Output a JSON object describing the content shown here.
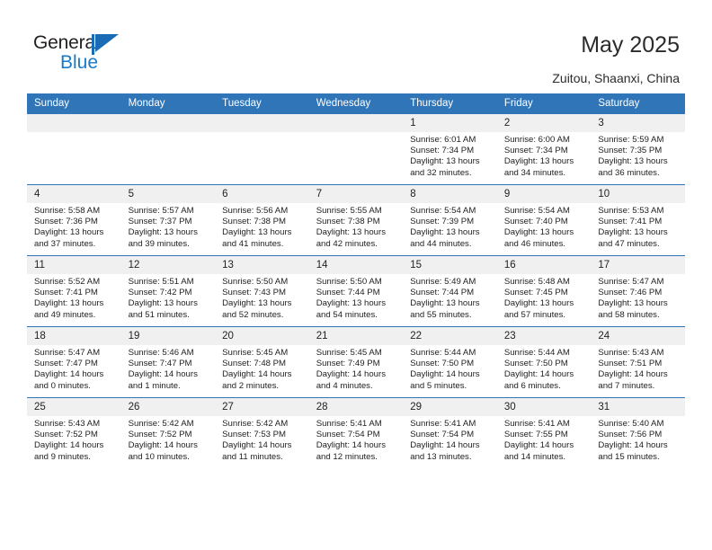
{
  "brand": {
    "name_part1": "General",
    "name_part2": "Blue",
    "accent_color": "#1a7ac8",
    "flag_icon": "triangle-flag-icon"
  },
  "header": {
    "title": "May 2025",
    "subtitle": "Zuitou, Shaanxi, China",
    "header_bg_color": "#3075b8",
    "daynum_bg_color": "#f0f0f0"
  },
  "weekday_headers": [
    "Sunday",
    "Monday",
    "Tuesday",
    "Wednesday",
    "Thursday",
    "Friday",
    "Saturday"
  ],
  "weeks": [
    [
      {
        "date": "",
        "empty": true,
        "sunrise": "",
        "sunset": "",
        "daylight1": "",
        "daylight2": ""
      },
      {
        "date": "",
        "empty": true,
        "sunrise": "",
        "sunset": "",
        "daylight1": "",
        "daylight2": ""
      },
      {
        "date": "",
        "empty": true,
        "sunrise": "",
        "sunset": "",
        "daylight1": "",
        "daylight2": ""
      },
      {
        "date": "",
        "empty": true,
        "sunrise": "",
        "sunset": "",
        "daylight1": "",
        "daylight2": ""
      },
      {
        "date": "1",
        "empty": false,
        "sunrise": "Sunrise: 6:01 AM",
        "sunset": "Sunset: 7:34 PM",
        "daylight1": "Daylight: 13 hours",
        "daylight2": "and 32 minutes."
      },
      {
        "date": "2",
        "empty": false,
        "sunrise": "Sunrise: 6:00 AM",
        "sunset": "Sunset: 7:34 PM",
        "daylight1": "Daylight: 13 hours",
        "daylight2": "and 34 minutes."
      },
      {
        "date": "3",
        "empty": false,
        "sunrise": "Sunrise: 5:59 AM",
        "sunset": "Sunset: 7:35 PM",
        "daylight1": "Daylight: 13 hours",
        "daylight2": "and 36 minutes."
      }
    ],
    [
      {
        "date": "4",
        "empty": false,
        "sunrise": "Sunrise: 5:58 AM",
        "sunset": "Sunset: 7:36 PM",
        "daylight1": "Daylight: 13 hours",
        "daylight2": "and 37 minutes."
      },
      {
        "date": "5",
        "empty": false,
        "sunrise": "Sunrise: 5:57 AM",
        "sunset": "Sunset: 7:37 PM",
        "daylight1": "Daylight: 13 hours",
        "daylight2": "and 39 minutes."
      },
      {
        "date": "6",
        "empty": false,
        "sunrise": "Sunrise: 5:56 AM",
        "sunset": "Sunset: 7:38 PM",
        "daylight1": "Daylight: 13 hours",
        "daylight2": "and 41 minutes."
      },
      {
        "date": "7",
        "empty": false,
        "sunrise": "Sunrise: 5:55 AM",
        "sunset": "Sunset: 7:38 PM",
        "daylight1": "Daylight: 13 hours",
        "daylight2": "and 42 minutes."
      },
      {
        "date": "8",
        "empty": false,
        "sunrise": "Sunrise: 5:54 AM",
        "sunset": "Sunset: 7:39 PM",
        "daylight1": "Daylight: 13 hours",
        "daylight2": "and 44 minutes."
      },
      {
        "date": "9",
        "empty": false,
        "sunrise": "Sunrise: 5:54 AM",
        "sunset": "Sunset: 7:40 PM",
        "daylight1": "Daylight: 13 hours",
        "daylight2": "and 46 minutes."
      },
      {
        "date": "10",
        "empty": false,
        "sunrise": "Sunrise: 5:53 AM",
        "sunset": "Sunset: 7:41 PM",
        "daylight1": "Daylight: 13 hours",
        "daylight2": "and 47 minutes."
      }
    ],
    [
      {
        "date": "11",
        "empty": false,
        "sunrise": "Sunrise: 5:52 AM",
        "sunset": "Sunset: 7:41 PM",
        "daylight1": "Daylight: 13 hours",
        "daylight2": "and 49 minutes."
      },
      {
        "date": "12",
        "empty": false,
        "sunrise": "Sunrise: 5:51 AM",
        "sunset": "Sunset: 7:42 PM",
        "daylight1": "Daylight: 13 hours",
        "daylight2": "and 51 minutes."
      },
      {
        "date": "13",
        "empty": false,
        "sunrise": "Sunrise: 5:50 AM",
        "sunset": "Sunset: 7:43 PM",
        "daylight1": "Daylight: 13 hours",
        "daylight2": "and 52 minutes."
      },
      {
        "date": "14",
        "empty": false,
        "sunrise": "Sunrise: 5:50 AM",
        "sunset": "Sunset: 7:44 PM",
        "daylight1": "Daylight: 13 hours",
        "daylight2": "and 54 minutes."
      },
      {
        "date": "15",
        "empty": false,
        "sunrise": "Sunrise: 5:49 AM",
        "sunset": "Sunset: 7:44 PM",
        "daylight1": "Daylight: 13 hours",
        "daylight2": "and 55 minutes."
      },
      {
        "date": "16",
        "empty": false,
        "sunrise": "Sunrise: 5:48 AM",
        "sunset": "Sunset: 7:45 PM",
        "daylight1": "Daylight: 13 hours",
        "daylight2": "and 57 minutes."
      },
      {
        "date": "17",
        "empty": false,
        "sunrise": "Sunrise: 5:47 AM",
        "sunset": "Sunset: 7:46 PM",
        "daylight1": "Daylight: 13 hours",
        "daylight2": "and 58 minutes."
      }
    ],
    [
      {
        "date": "18",
        "empty": false,
        "sunrise": "Sunrise: 5:47 AM",
        "sunset": "Sunset: 7:47 PM",
        "daylight1": "Daylight: 14 hours",
        "daylight2": "and 0 minutes."
      },
      {
        "date": "19",
        "empty": false,
        "sunrise": "Sunrise: 5:46 AM",
        "sunset": "Sunset: 7:47 PM",
        "daylight1": "Daylight: 14 hours",
        "daylight2": "and 1 minute."
      },
      {
        "date": "20",
        "empty": false,
        "sunrise": "Sunrise: 5:45 AM",
        "sunset": "Sunset: 7:48 PM",
        "daylight1": "Daylight: 14 hours",
        "daylight2": "and 2 minutes."
      },
      {
        "date": "21",
        "empty": false,
        "sunrise": "Sunrise: 5:45 AM",
        "sunset": "Sunset: 7:49 PM",
        "daylight1": "Daylight: 14 hours",
        "daylight2": "and 4 minutes."
      },
      {
        "date": "22",
        "empty": false,
        "sunrise": "Sunrise: 5:44 AM",
        "sunset": "Sunset: 7:50 PM",
        "daylight1": "Daylight: 14 hours",
        "daylight2": "and 5 minutes."
      },
      {
        "date": "23",
        "empty": false,
        "sunrise": "Sunrise: 5:44 AM",
        "sunset": "Sunset: 7:50 PM",
        "daylight1": "Daylight: 14 hours",
        "daylight2": "and 6 minutes."
      },
      {
        "date": "24",
        "empty": false,
        "sunrise": "Sunrise: 5:43 AM",
        "sunset": "Sunset: 7:51 PM",
        "daylight1": "Daylight: 14 hours",
        "daylight2": "and 7 minutes."
      }
    ],
    [
      {
        "date": "25",
        "empty": false,
        "sunrise": "Sunrise: 5:43 AM",
        "sunset": "Sunset: 7:52 PM",
        "daylight1": "Daylight: 14 hours",
        "daylight2": "and 9 minutes."
      },
      {
        "date": "26",
        "empty": false,
        "sunrise": "Sunrise: 5:42 AM",
        "sunset": "Sunset: 7:52 PM",
        "daylight1": "Daylight: 14 hours",
        "daylight2": "and 10 minutes."
      },
      {
        "date": "27",
        "empty": false,
        "sunrise": "Sunrise: 5:42 AM",
        "sunset": "Sunset: 7:53 PM",
        "daylight1": "Daylight: 14 hours",
        "daylight2": "and 11 minutes."
      },
      {
        "date": "28",
        "empty": false,
        "sunrise": "Sunrise: 5:41 AM",
        "sunset": "Sunset: 7:54 PM",
        "daylight1": "Daylight: 14 hours",
        "daylight2": "and 12 minutes."
      },
      {
        "date": "29",
        "empty": false,
        "sunrise": "Sunrise: 5:41 AM",
        "sunset": "Sunset: 7:54 PM",
        "daylight1": "Daylight: 14 hours",
        "daylight2": "and 13 minutes."
      },
      {
        "date": "30",
        "empty": false,
        "sunrise": "Sunrise: 5:41 AM",
        "sunset": "Sunset: 7:55 PM",
        "daylight1": "Daylight: 14 hours",
        "daylight2": "and 14 minutes."
      },
      {
        "date": "31",
        "empty": false,
        "sunrise": "Sunrise: 5:40 AM",
        "sunset": "Sunset: 7:56 PM",
        "daylight1": "Daylight: 14 hours",
        "daylight2": "and 15 minutes."
      }
    ]
  ]
}
